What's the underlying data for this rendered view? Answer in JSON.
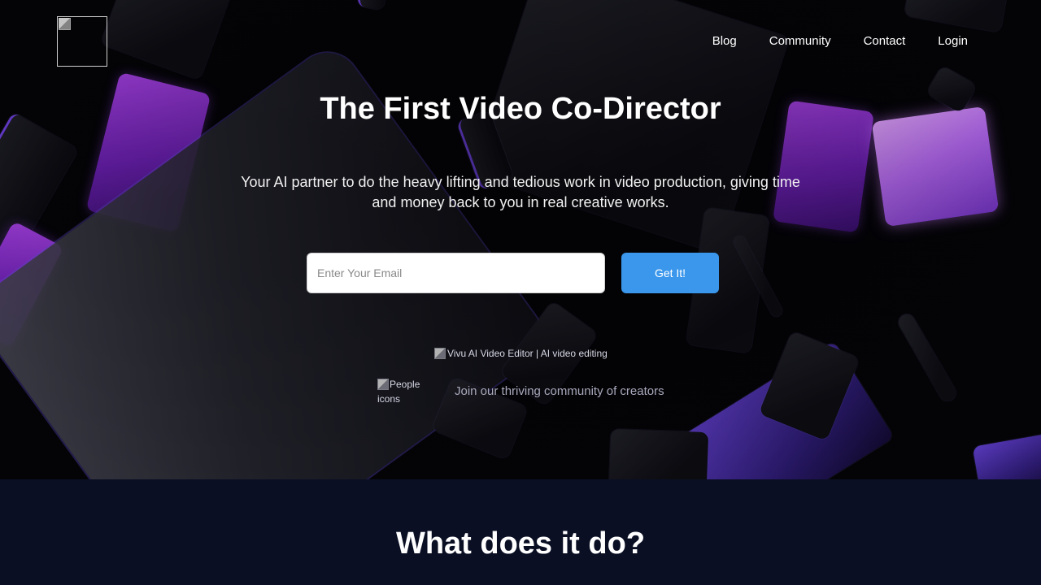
{
  "nav": {
    "logo_alt": "",
    "links": [
      {
        "label": "Blog"
      },
      {
        "label": "Community"
      },
      {
        "label": "Contact"
      },
      {
        "label": "Login"
      }
    ]
  },
  "hero": {
    "title": "The First Video Co-Director",
    "subtitle": "Your AI partner to do the heavy lifting and tedious work in video production, giving time and money back to you in real creative works.",
    "email_placeholder": "Enter Your Email",
    "email_value": "",
    "cta_label": "Get It!",
    "product_image_alt": "Vivu AI Video Editor | AI video editing",
    "people_image_alt": "People icons",
    "community_text": "Join our thriving community of creators"
  },
  "features": {
    "heading": "What does it do?"
  },
  "colors": {
    "cta_background": "#3a97ec",
    "section_background": "#0a0f24",
    "accent_purple": "#a23fe0"
  }
}
